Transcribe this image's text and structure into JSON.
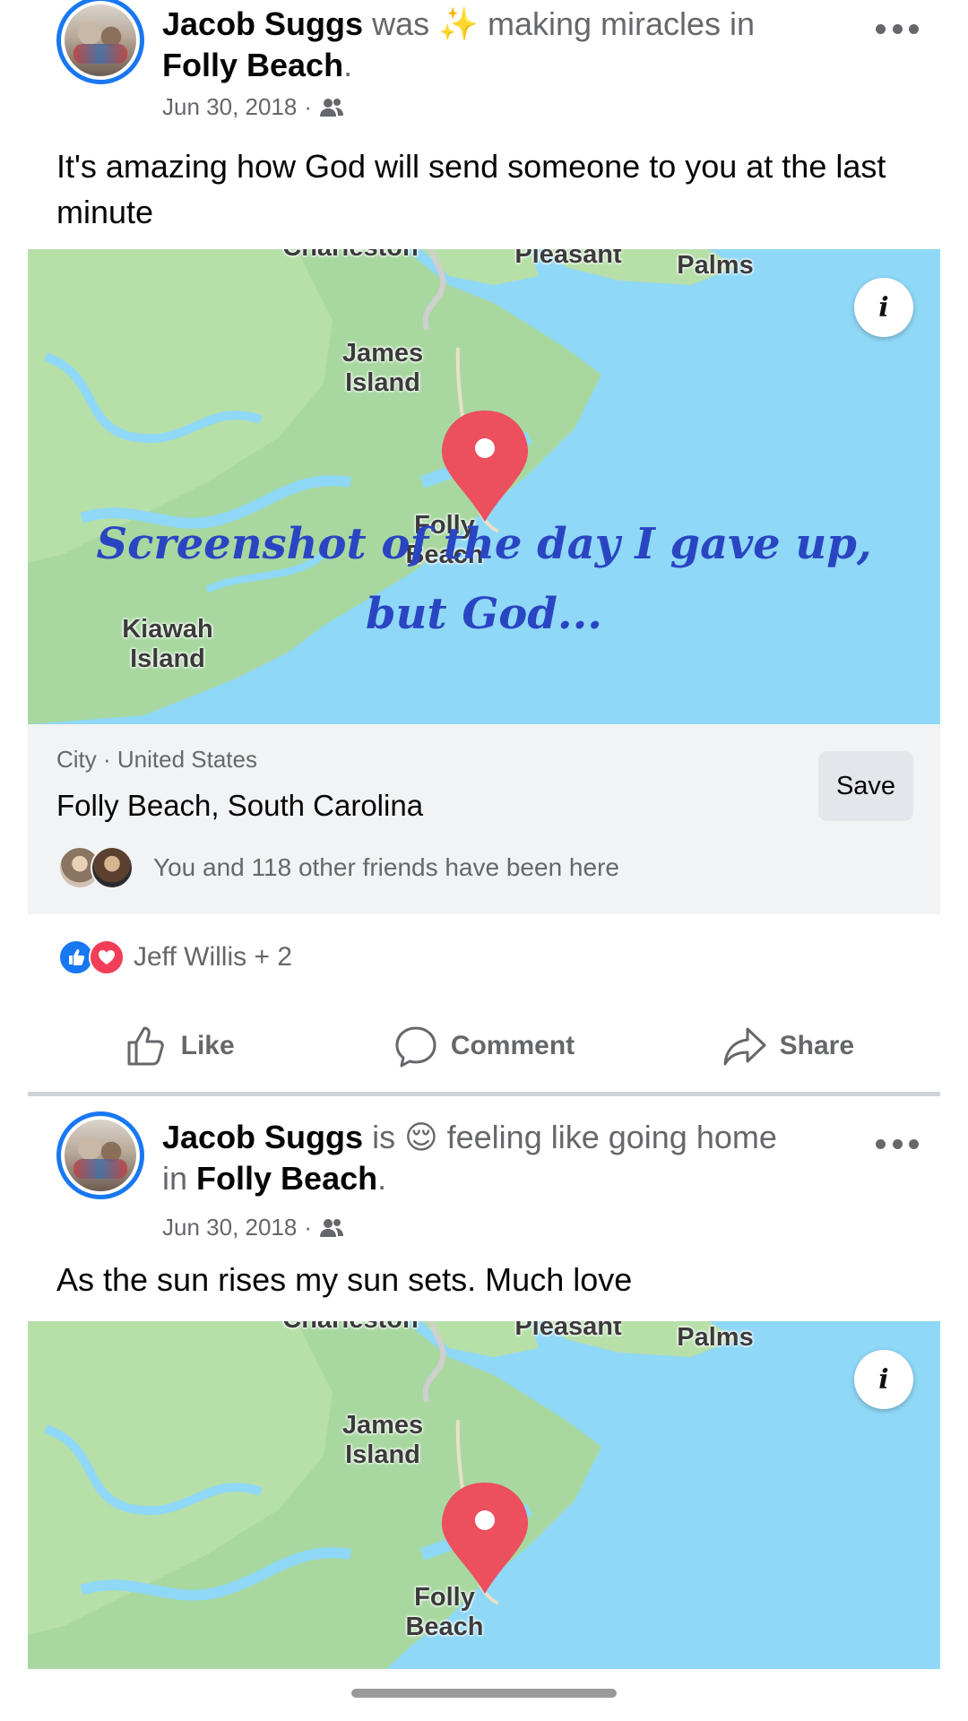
{
  "posts": [
    {
      "author": "Jacob Suggs",
      "activity_verb": "was",
      "activity_emoji": "✨",
      "activity_text": "making miracles in",
      "place": "Folly Beach",
      "date": "Jun 30, 2018",
      "audience_icon": "friends-icon",
      "text": "It's amazing how God will send someone to you at the last minute",
      "map_labels": {
        "charleston": "Charleston",
        "pleasant": "Pleasant",
        "palms": "Palms",
        "james_island": "James\nIsland",
        "folly_beach": "Folly\nBeach",
        "kiawah_island": "Kiawah\nIsland"
      },
      "overlay_text": [
        "Screenshot of the day I gave up,",
        "but God..."
      ],
      "place_card": {
        "category": "City · United States",
        "name": "Folly Beach, South Carolina",
        "save_label": "Save",
        "friends_text": "You and 118 other friends have been here"
      },
      "reactions_text": "Jeff Willis + 2",
      "actions": {
        "like": "Like",
        "comment": "Comment",
        "share": "Share"
      }
    },
    {
      "author": "Jacob Suggs",
      "activity_verb": "is",
      "activity_emoji": "😌",
      "activity_text": "feeling like going home",
      "activity_in": "in",
      "place": "Folly Beach",
      "date": "Jun 30, 2018",
      "audience_icon": "friends-icon",
      "text": "As the sun rises my sun sets. Much love",
      "map_labels": {
        "charleston": "Charleston",
        "pleasant": "Pleasant",
        "palms": "Palms",
        "james_island": "James\nIsland",
        "folly_beach": "Folly\nBeach"
      }
    }
  ],
  "colors": {
    "facebook_blue": "#1877f2",
    "love_red": "#f33e58",
    "map_water": "#8fd8f7",
    "map_land": "#a8d8a0",
    "pin": "#ec4f5e",
    "overlay_text": "#2a45c2"
  }
}
